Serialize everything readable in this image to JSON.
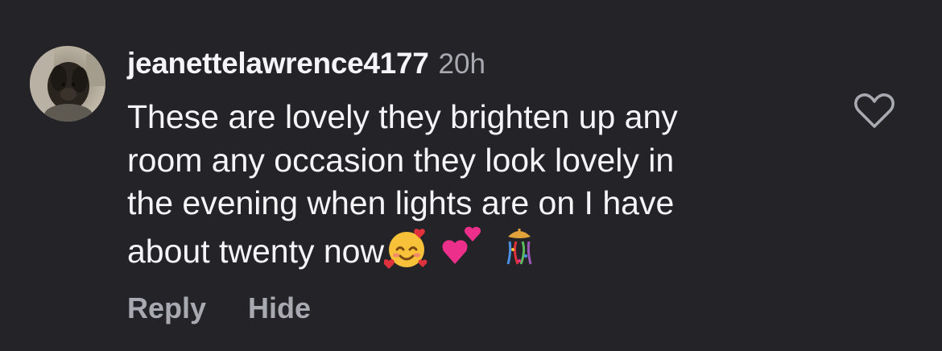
{
  "comment": {
    "username": "jeanettelawrence4177",
    "time": "20h",
    "lines": [
      "These are lovely they brighten up any",
      "room any occasion they look lovely in",
      "the evening when lights are on I have",
      "about twenty now"
    ],
    "emojis": [
      "smiling-face-with-hearts",
      "two-hearts",
      "confetti-ball"
    ]
  },
  "actions": {
    "reply": "Reply",
    "hide": "Hide"
  },
  "colors": {
    "background": "#232328",
    "text": "#f5f5f7",
    "secondary": "#a9a9b2"
  }
}
